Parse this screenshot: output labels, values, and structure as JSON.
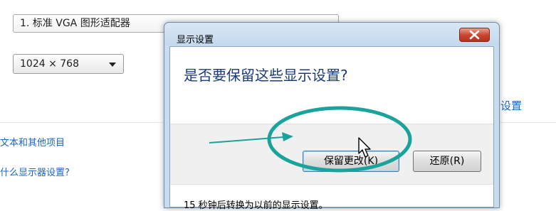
{
  "background": {
    "display_adapter": "1. 标准 VGA 图形适配器",
    "resolution": "1024 × 768",
    "settings_link": "设置",
    "text_items_link": "文本和其他项目",
    "which_settings_link": "什么显示器设置?"
  },
  "dialog": {
    "title": "显示设置",
    "question": "是否要保留这些显示设置?",
    "keep_button": "保留更改(K)",
    "revert_button": "还原(R)",
    "countdown": "15 秒钟后转换为以前的显示设置。"
  },
  "icons": {
    "close": "close-icon",
    "cursor": "mouse-pointer-icon"
  },
  "colors": {
    "annotation": "#1aa39a",
    "link": "#1a66c2",
    "close_button": "#c8432e",
    "question_text": "#1c3a7e"
  }
}
